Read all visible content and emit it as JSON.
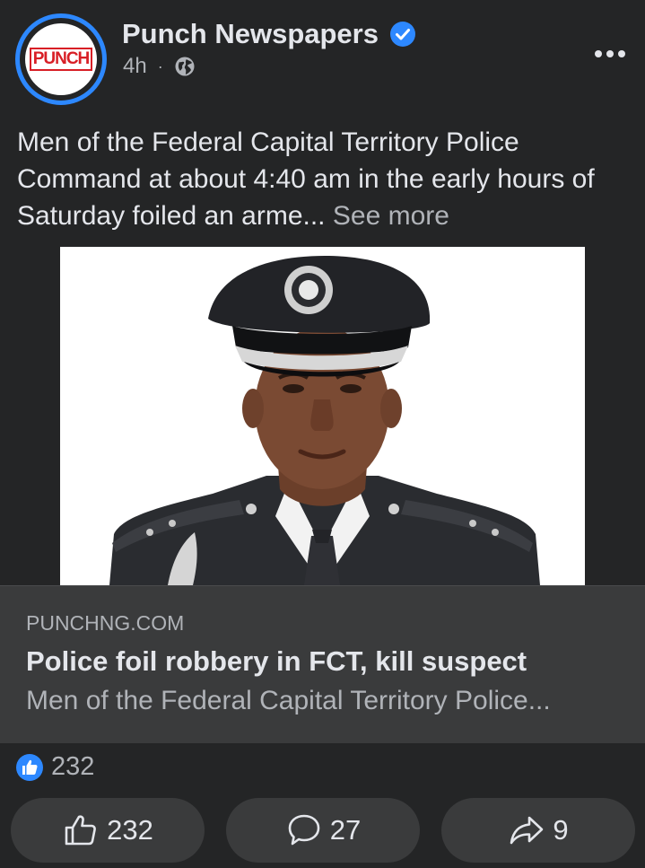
{
  "post": {
    "page_name": "Punch Newspapers",
    "logo_text": "PUNCH",
    "time": "4h",
    "separator": "·",
    "body": "Men of the Federal Capital Territory Police Command at about 4:40 am in the early hours of Saturday foiled an arme...",
    "see_more": "See more"
  },
  "link_preview": {
    "domain": "PUNCHNG.COM",
    "title": "Police foil robbery in FCT, kill suspect",
    "description": "Men of the Federal Capital Territory Police..."
  },
  "stats": {
    "reaction_count": "232"
  },
  "actions": {
    "like_count": "232",
    "comment_count": "27",
    "share_count": "9"
  },
  "icons": {
    "verified": "verified-badge-icon",
    "audience": "globe-icon",
    "more": "more-options-icon",
    "like_reaction": "like-reaction-icon",
    "like": "thumbs-up-icon",
    "comment": "comment-icon",
    "share": "share-icon"
  },
  "colors": {
    "background": "#242526",
    "accent": "#2d88ff",
    "card": "#3a3b3c",
    "brand": "#d81f26"
  }
}
